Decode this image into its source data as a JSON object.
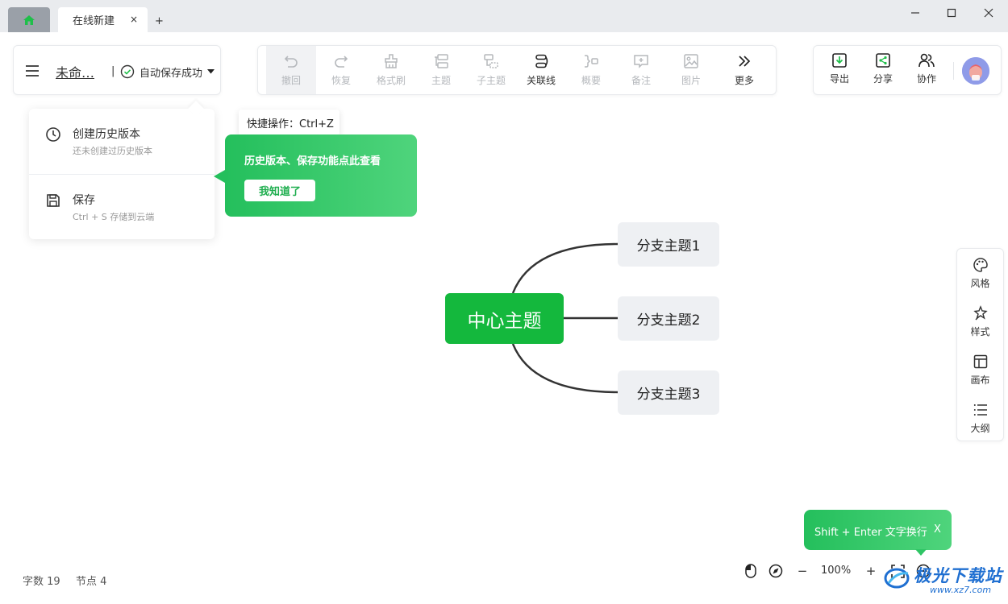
{
  "tabs": {
    "doc_tab_label": "在线新建",
    "close_glyph": "×",
    "new_tab_glyph": "+"
  },
  "file": {
    "title": "未命…",
    "separator": "|",
    "save_status": "自动保存成功"
  },
  "toolbar": {
    "items": [
      {
        "label": "撤回",
        "icon": "undo-icon"
      },
      {
        "label": "恢复",
        "icon": "redo-icon"
      },
      {
        "label": "格式刷",
        "icon": "format-brush-icon"
      },
      {
        "label": "主题",
        "icon": "topic-icon"
      },
      {
        "label": "子主题",
        "icon": "subtopic-icon"
      },
      {
        "label": "关联线",
        "icon": "relation-line-icon"
      },
      {
        "label": "概要",
        "icon": "summary-icon"
      },
      {
        "label": "备注",
        "icon": "note-icon"
      },
      {
        "label": "图片",
        "icon": "image-icon"
      },
      {
        "label": "更多",
        "icon": "more-icon"
      }
    ]
  },
  "right_toolbar": {
    "export": "导出",
    "share": "分享",
    "collaborate": "协作"
  },
  "tooltip": {
    "text": "快捷操作：Ctrl+Z"
  },
  "history_menu": {
    "create_title": "创建历史版本",
    "create_sub": "还未创建过历史版本",
    "save_title": "保存",
    "save_sub": "Ctrl + S 存储到云端"
  },
  "green_tip": {
    "message": "历史版本、保存功能点此查看",
    "button": "我知道了"
  },
  "mindmap": {
    "center": "中心主题",
    "branches": [
      "分支主题1",
      "分支主题2",
      "分支主题3"
    ]
  },
  "side_dock": {
    "style": "风格",
    "format": "样式",
    "canvas": "画布",
    "outline": "大纲"
  },
  "status": {
    "word_count": "字数 19",
    "node_count": "节点 4",
    "zoom": "100%",
    "zoom_out": "−",
    "zoom_in": "+"
  },
  "shift_tip": {
    "text": "Shift + Enter 文字换行",
    "close": "X"
  },
  "watermark": {
    "text": "极光下载站",
    "url": "www.xz7.com"
  },
  "colors": {
    "brand_green": "#14b83d",
    "tip_green": "#24bf5c",
    "watermark_blue": "#1f6fd1"
  }
}
